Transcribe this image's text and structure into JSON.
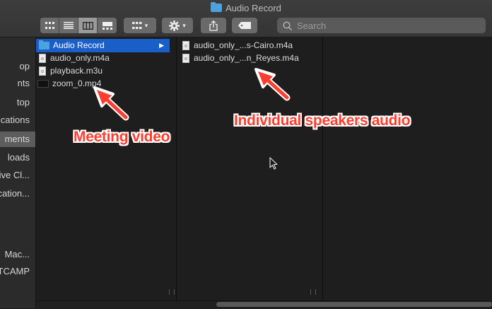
{
  "window": {
    "title": "Audio Record"
  },
  "toolbar": {
    "search_placeholder": "Search",
    "view_buttons": [
      "icon-view",
      "list-view",
      "column-view",
      "gallery-view"
    ],
    "selected_view": "column-view"
  },
  "sidebar": {
    "items": [
      {
        "label": "op"
      },
      {
        "label": "nts"
      },
      {
        "label": "top"
      },
      {
        "label": "ications"
      },
      {
        "label": "ments"
      },
      {
        "label": "loads"
      },
      {
        "label": "ive Cl..."
      },
      {
        "label": "ication..."
      },
      {
        "label": "Mac..."
      },
      {
        "label": "TCAMP"
      }
    ],
    "selected_index": 4
  },
  "column1": {
    "items": [
      {
        "label": "Audio Record",
        "icon": "folder-icon"
      },
      {
        "label": "audio_only.m4a",
        "icon": "audio-file-icon"
      },
      {
        "label": "playback.m3u",
        "icon": "playlist-file-icon"
      },
      {
        "label": "zoom_0.mp4",
        "icon": "video-file-icon"
      }
    ]
  },
  "column2": {
    "items": [
      {
        "label": "audio_only_...s-Cairo.m4a",
        "icon": "audio-file-icon"
      },
      {
        "label": "audio_only_...n_Reyes.m4a",
        "icon": "audio-file-icon"
      }
    ]
  },
  "annotations": {
    "meeting_video": "Meeting video",
    "speakers_audio": "Individual speakers audio"
  },
  "colors": {
    "selection": "#1a5fc7",
    "annotation_red": "#ff3d2e",
    "folder_blue": "#4aa3df"
  }
}
